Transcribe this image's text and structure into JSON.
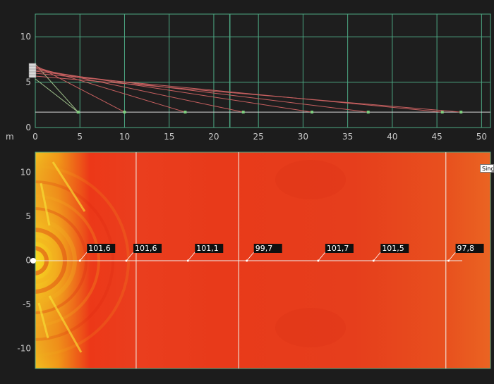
{
  "top_view": {
    "unit_label": "m",
    "x_ticks": [
      "0",
      "5",
      "10",
      "15",
      "20",
      "25",
      "30",
      "35",
      "40",
      "45",
      "50"
    ],
    "y_ticks": [
      "10",
      "5",
      "0"
    ],
    "x_range": [
      0,
      51
    ],
    "y_range": [
      0,
      12.5
    ],
    "array_position": {
      "x": 0,
      "y": 5.9
    },
    "listener_height": 1.7,
    "ray_targets": [
      4.8,
      10,
      16.8,
      23.3,
      31,
      37.3,
      45.6,
      47.7
    ],
    "grid_color": "#4da883",
    "ray_color": "#c86060",
    "listener_color": "#9ec08a"
  },
  "map_view": {
    "y_ticks": [
      "10",
      "5",
      "0",
      "-5",
      "-10"
    ],
    "x_range": [
      0,
      51
    ],
    "y_range": [
      -12.3,
      12.3
    ],
    "zone_boundaries": [
      11.3,
      22.8,
      46
    ],
    "readings": [
      {
        "x": 5,
        "value": "101,6"
      },
      {
        "x": 10.2,
        "value": "101,6"
      },
      {
        "x": 17.1,
        "value": "101,1"
      },
      {
        "x": 23.7,
        "value": "99,7"
      },
      {
        "x": 31.7,
        "value": "101,7"
      },
      {
        "x": 37.9,
        "value": "101,5"
      },
      {
        "x": 46.3,
        "value": "97,8"
      }
    ],
    "button_label": "Single"
  }
}
